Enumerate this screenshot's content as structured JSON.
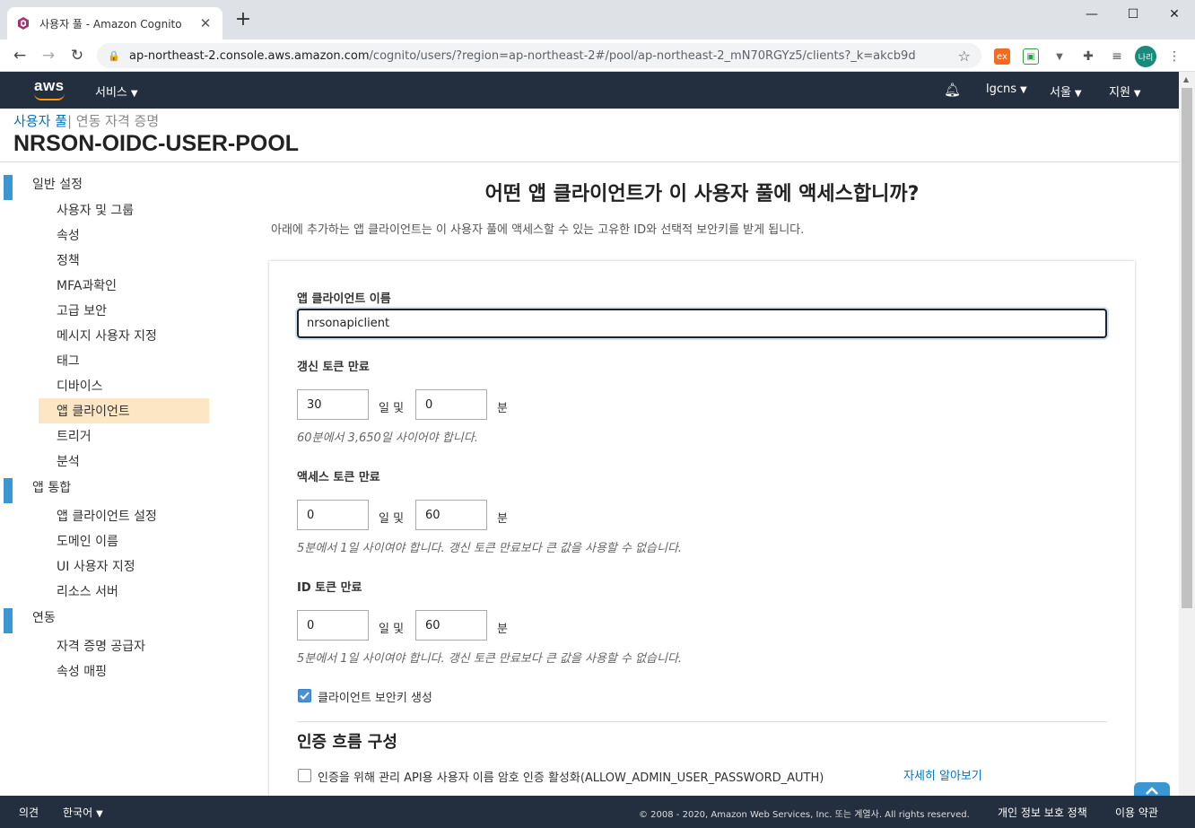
{
  "browser": {
    "tab_title": "사용자 풀 - Amazon Cognito",
    "url_host": "ap-northeast-2.console.aws.amazon.com",
    "url_path": "/cognito/users/?region=ap-northeast-2#/pool/ap-northeast-2_mN70RGYz5/clients?_k=akcb9d",
    "profile_label": "나리"
  },
  "awsnav": {
    "logo": "aws",
    "services": "서비스",
    "account": "lgcns",
    "region": "서울",
    "support": "지원"
  },
  "header": {
    "crumb_link": "사용자 풀",
    "crumb_rest": "연동 자격 증명",
    "pool_name": "NRSON-OIDC-USER-POOL"
  },
  "sidebar": {
    "sections": [
      {
        "label": "일반 설정",
        "items": [
          "사용자 및 그룹",
          "속성",
          "정책",
          "MFA과확인",
          "고급 보안",
          "메시지 사용자 지정",
          "태그",
          "디바이스",
          "앱 클라이언트",
          "트리거",
          "분석"
        ]
      },
      {
        "label": "앱 통합",
        "items": [
          "앱 클라이언트 설정",
          "도메인 이름",
          "UI 사용자 지정",
          "리소스 서버"
        ]
      },
      {
        "label": "연동",
        "items": [
          "자격 증명 공급자",
          "속성 매핑"
        ]
      }
    ],
    "active_item": "앱 클라이언트"
  },
  "main": {
    "title": "어떤 앱 클라이언트가 이 사용자 풀에 액세스합니까?",
    "description": "아래에 추가하는 앱 클라이언트는 이 사용자 풀에 액세스할 수 있는 고유한 ID와 선택적 보안키를 받게 됩니다."
  },
  "form": {
    "client_name_label": "앱 클라이언트 이름",
    "client_name_value": "nrsonapiclient",
    "refresh_label": "갱신 토큰 만료",
    "refresh_days": "30",
    "refresh_minutes": "0",
    "refresh_hint": "60분에서 3,650일 사이어야 합니다.",
    "access_label": "액세스 토큰 만료",
    "access_days": "0",
    "access_minutes": "60",
    "access_hint": "5분에서 1일 사이여야 합니다. 갱신 토큰 만료보다 큰 값을 사용할 수 없습니다.",
    "id_label": "ID 토큰 만료",
    "id_days": "0",
    "id_minutes": "60",
    "id_hint": "5분에서 1일 사이여야 합니다. 갱신 토큰 만료보다 큰 값을 사용할 수 없습니다.",
    "unit_days": "일 및",
    "unit_minutes": "분",
    "secret_label": "클라이언트 보안키 생성",
    "secret_checked": true,
    "auth_heading": "인증 흐름 구성",
    "auth_option": "인증을 위해 관리 API용 사용자 이름 암호 인증 활성화(ALLOW_ADMIN_USER_PASSWORD_AUTH)",
    "auth_checked": false,
    "learn_more": "자세히 알아보기"
  },
  "footer": {
    "feedback": "의견",
    "language": "한국어",
    "copyright": "© 2008 - 2020, Amazon Web Services, Inc. 또는 계열사. All rights reserved.",
    "privacy": "개인 정보 보호 정책",
    "terms": "이용 약관"
  },
  "colors": {
    "aws_nav": "#232f3e",
    "accent": "#3b97d3",
    "link": "#0073bb",
    "active_item": "#fce6c4",
    "aws_orange": "#ff9900"
  }
}
